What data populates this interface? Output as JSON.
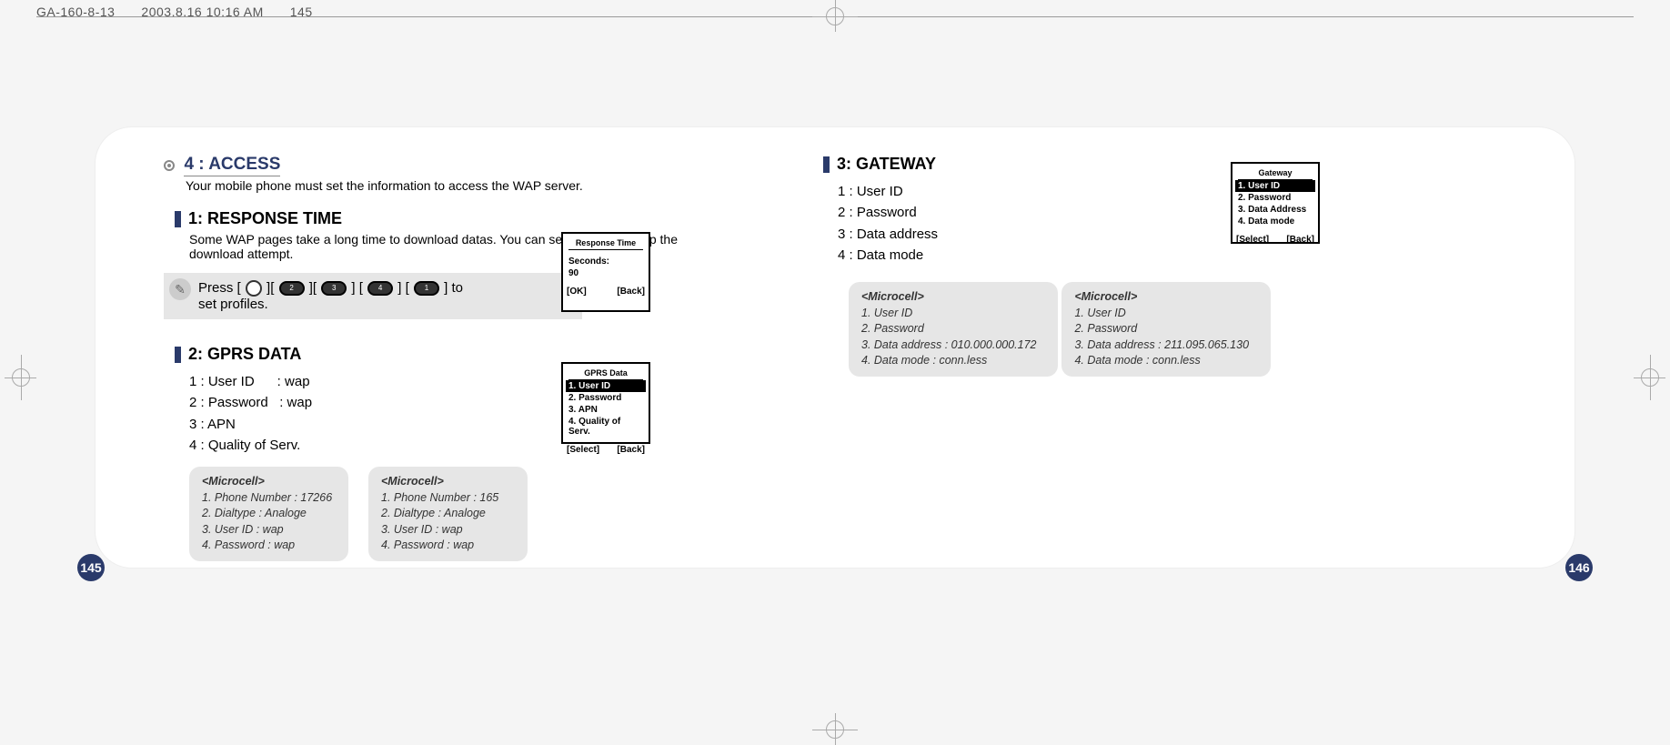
{
  "header": {
    "file_info": "GA-160-8-13  2003.8.16 10:16 AM  145"
  },
  "left": {
    "main_title": "4 : ACCESS",
    "main_desc": "Your mobile phone must set the information to access the WAP server.",
    "sub1_title": "1: RESPONSE TIME",
    "sub1_desc": "Some WAP pages take a long time to download datas. You can set the time to stop the download attempt.",
    "tip_prefix": "Press [",
    "tip_mid1": "][",
    "tip_mid2": "][",
    "tip_mid3": "] [",
    "tip_mid4": "] [",
    "tip_suffix": "] to",
    "tip_line2": "set profiles.",
    "sub2_title": "2: GPRS DATA",
    "items": {
      "i1": "1 : User ID      : wap",
      "i2": "2 : Password   : wap",
      "i3": "3 : APN",
      "i4": "4 : Quality of Serv."
    },
    "profile1": {
      "t": "<Microcell>",
      "l1": "1. Phone Number : 17266",
      "l2": "2. Dialtype : Analoge",
      "l3": "3. User ID : wap",
      "l4": "4. Password : wap"
    },
    "profile2": {
      "t": "<Microcell>",
      "l1": "1. Phone Number : 165",
      "l2": "2. Dialtype : Analoge",
      "l3": "3. User ID : wap",
      "l4": "4. Password : wap"
    }
  },
  "right": {
    "sub3_title": "3: GATEWAY",
    "items": {
      "i1": "1 : User ID",
      "i2": "2 : Password",
      "i3": "3 : Data address",
      "i4": "4 : Data mode"
    },
    "profile1": {
      "t": "<Microcell>",
      "l1": "1. User ID",
      "l2": "2. Password",
      "l3": "3. Data address : 010.000.000.172",
      "l4": "4. Data mode : conn.less"
    },
    "profile2": {
      "t": "<Microcell>",
      "l1": "1. User ID",
      "l2": "2. Password",
      "l3": "3. Data address : 211.095.065.130",
      "l4": "4. Data mode : conn.less"
    }
  },
  "screens": {
    "response": {
      "title": "Response Time",
      "r1": "Seconds:",
      "r2": "90",
      "left": "[OK]",
      "right": "[Back]"
    },
    "gprs": {
      "title": "GPRS Data",
      "r1": "1. User ID",
      "r2": "2. Password",
      "r3": "3. APN",
      "r4": "4. Quality of Serv.",
      "left": "[Select]",
      "right": "[Back]"
    },
    "gateway": {
      "title": "Gateway",
      "r1": "1. User ID",
      "r2": "2. Password",
      "r3": "3. Data Address",
      "r4": "4. Data mode",
      "left": "[Select]",
      "right": "[Back]"
    }
  },
  "pages": {
    "left": "145",
    "right": "146"
  }
}
